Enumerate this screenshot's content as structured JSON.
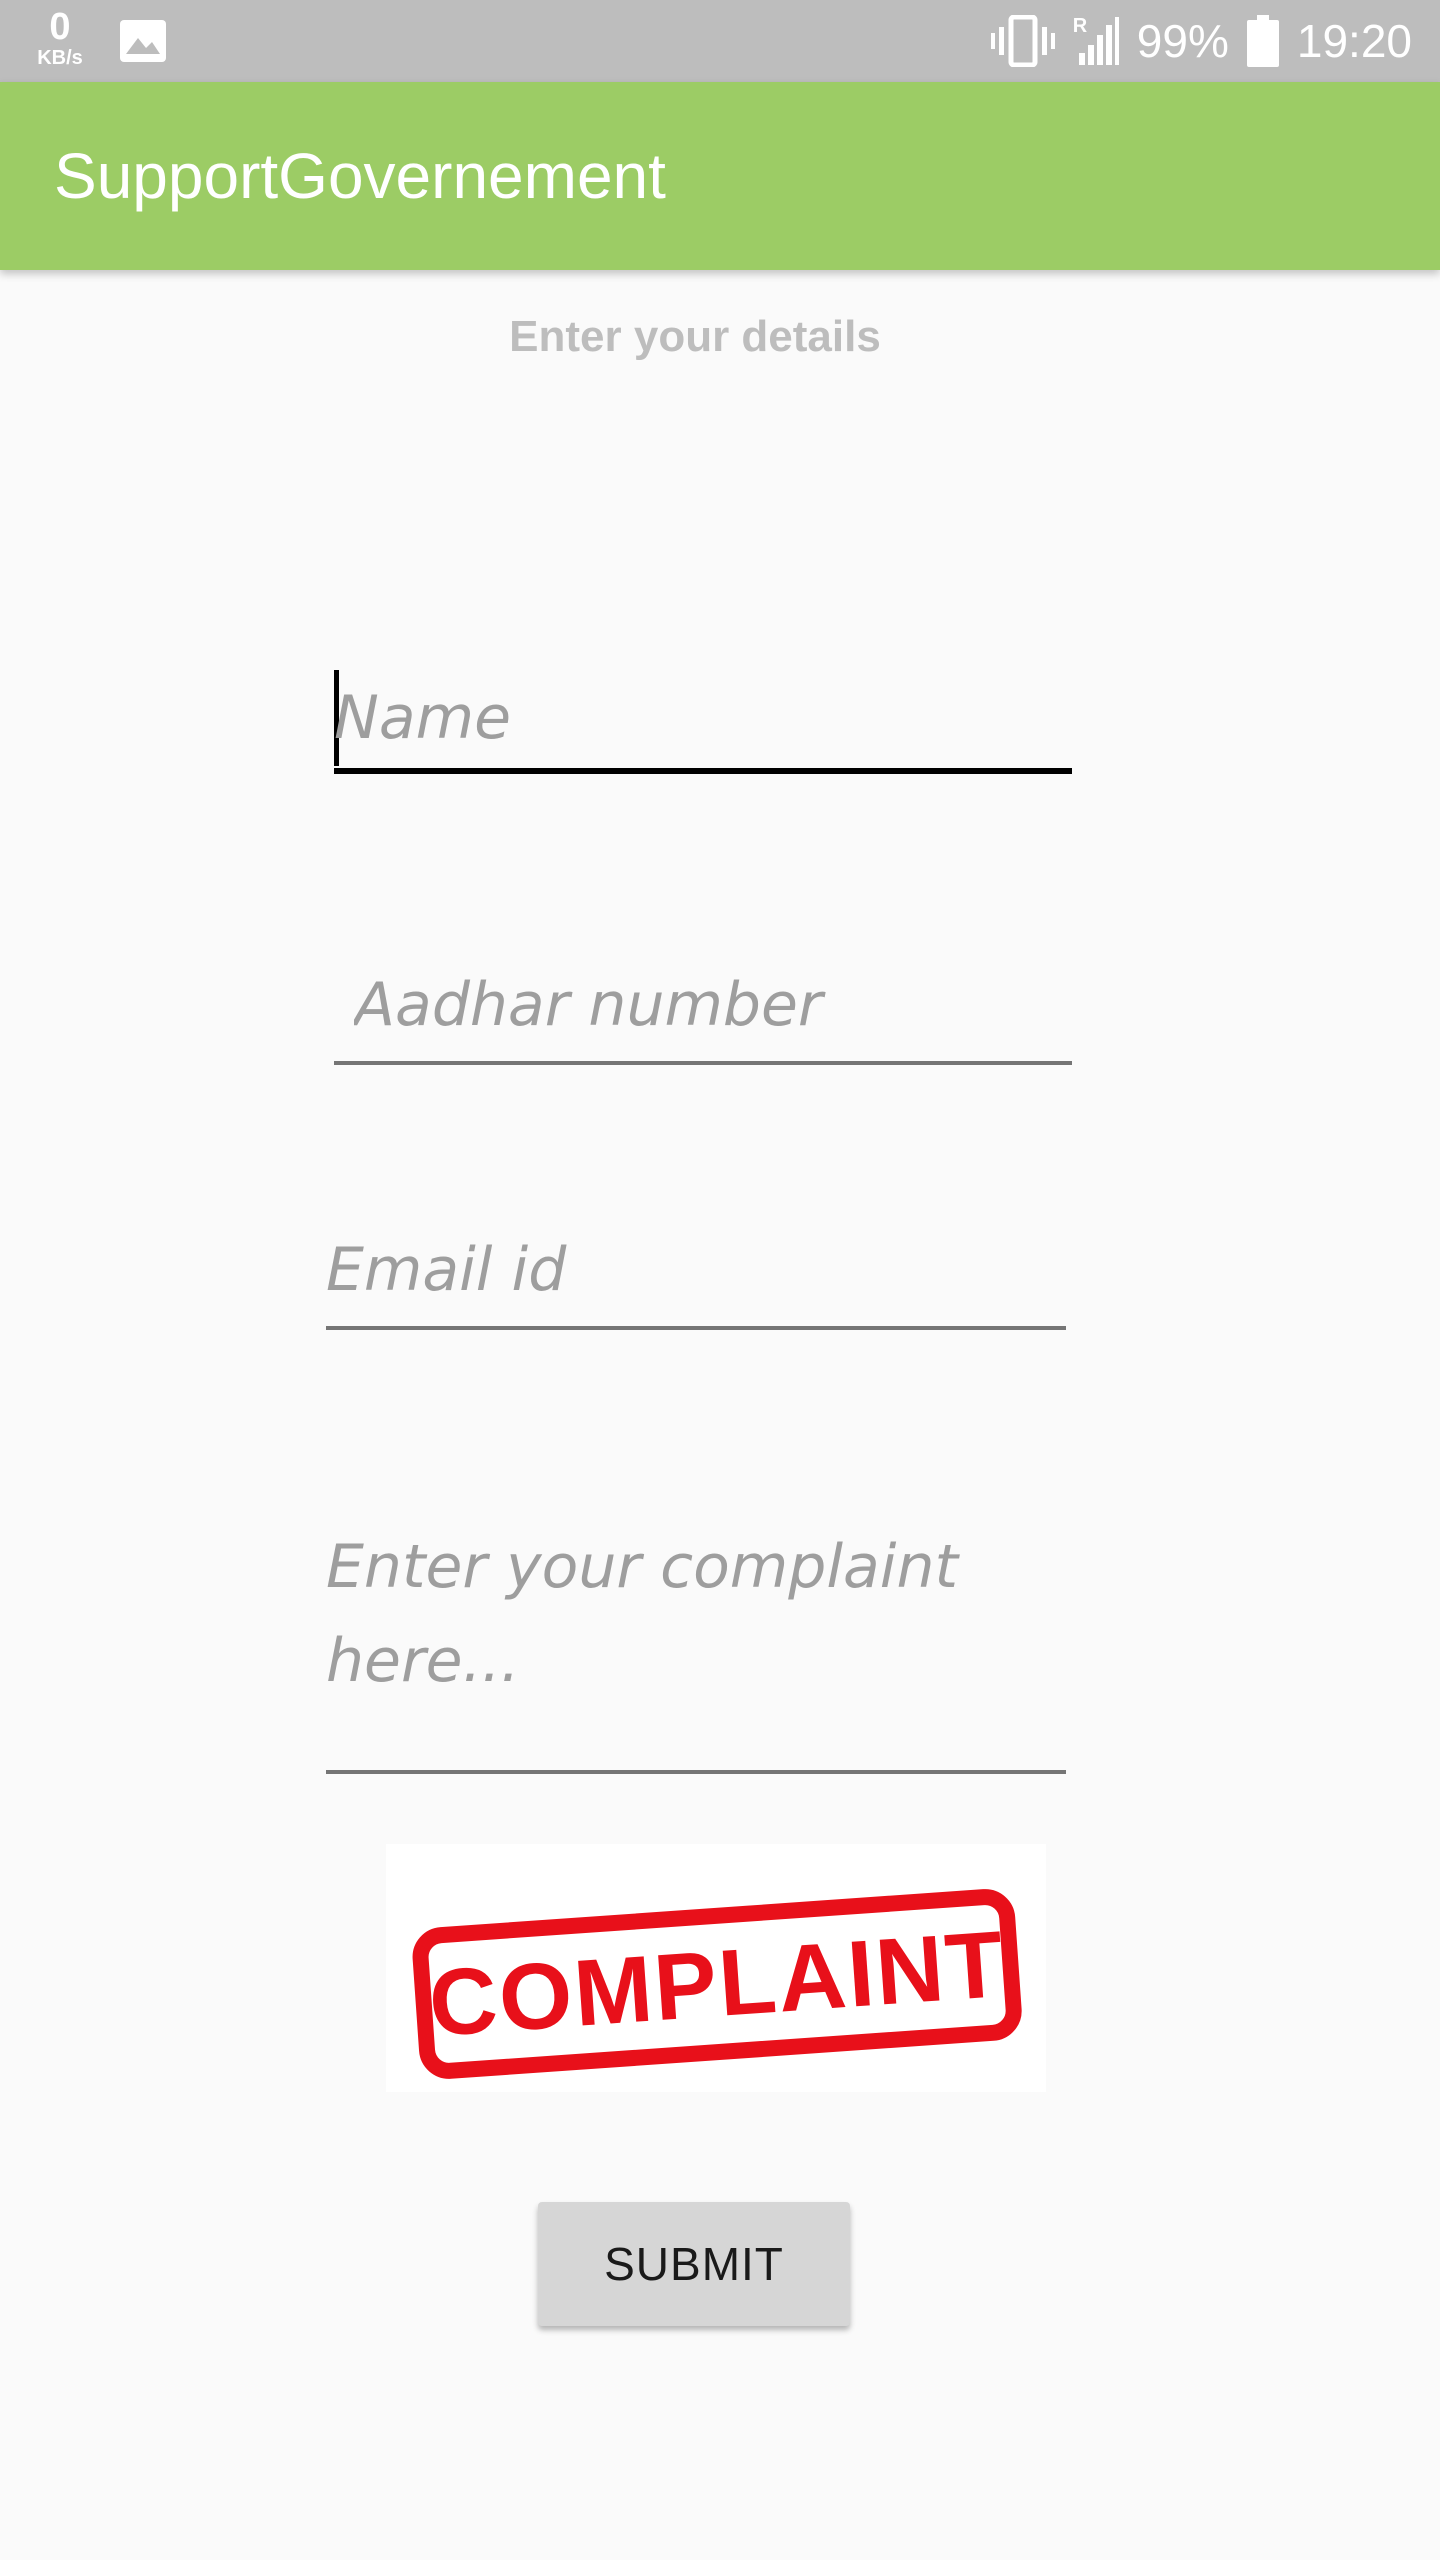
{
  "status_bar": {
    "net_speed_value": "0",
    "net_speed_unit": "KB/s",
    "battery_percent": "99%",
    "time": "19:20",
    "signal_label": "R",
    "icons": [
      "image-icon",
      "vibrate-icon",
      "signal-icon",
      "battery-icon"
    ]
  },
  "app_bar": {
    "title": "SupportGovernement",
    "color": "#9ccc65"
  },
  "form": {
    "subtitle": "Enter your details",
    "name_placeholder": "Name",
    "aadhar_placeholder": "Aadhar number",
    "email_placeholder": "Email id",
    "complaint_placeholder": "Enter your complaint here...",
    "submit_label": "SUBMIT"
  },
  "complaint_image": {
    "stamp_text": "COMPLAINT",
    "stamp_color": "#e8101a"
  }
}
